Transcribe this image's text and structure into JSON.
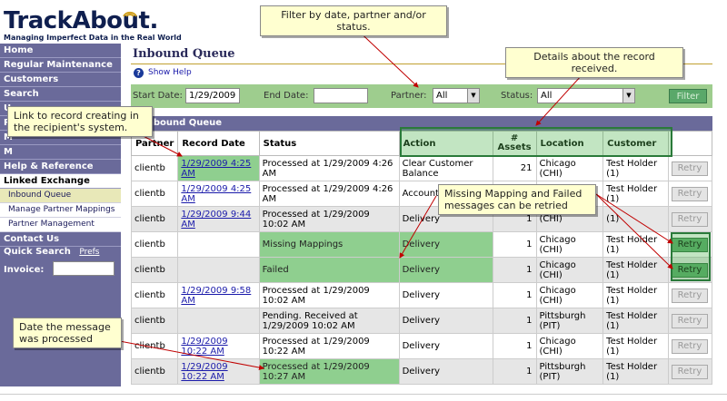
{
  "logo": {
    "name": "TrackAbout.",
    "tagline": "Managing Imperfect Data in the Real World"
  },
  "sidebar": {
    "sections": [
      "Home",
      "Regular Maintenance",
      "Customers",
      "Search",
      "U",
      "R",
      "M",
      "M"
    ],
    "help": "Help & Reference",
    "linked": "Linked Exchange",
    "sub_items": [
      "Inbound Queue",
      "Manage Partner Mappings",
      "Partner Management"
    ],
    "contact": "Contact Us",
    "quick_search": "Quick Search",
    "prefs": "Prefs",
    "invoice_label": "Invoice:",
    "invoice_value": ""
  },
  "page": {
    "title": "Inbound Queue",
    "show_help": "Show Help"
  },
  "filter": {
    "start_label": "Start Date:",
    "start_value": "1/29/2009",
    "end_label": "End Date:",
    "end_value": "",
    "partner_label": "Partner:",
    "partner_value": "All",
    "status_label": "Status:",
    "status_value": "All",
    "button": "Filter"
  },
  "grid": {
    "heading": "Inbound Queue",
    "columns": [
      "Partner",
      "Record Date",
      "Status",
      "Action",
      "# Assets",
      "Location",
      "Customer",
      ""
    ],
    "rows": [
      {
        "partner": "clientb",
        "date": "1/29/2009 4:25 AM",
        "status": "Processed at 1/29/2009 4:26 AM",
        "action": "Clear Customer Balance",
        "assets": "21",
        "location": "Chicago (CHI)",
        "customer": "Test Holder (1)",
        "retry": "Retry"
      },
      {
        "partner": "clientb",
        "date": "1/29/2009 4:25 AM",
        "status": "Processed at 1/29/2009 4:26 AM",
        "action": "Account Adjustm",
        "assets": "",
        "location": "",
        "customer": "Test Holder (1)",
        "retry": "Retry"
      },
      {
        "partner": "clientb",
        "date": "1/29/2009 9:44 AM",
        "status": "Processed at 1/29/2009 10:02 AM",
        "action": "Delivery",
        "assets": "1",
        "location": "(CHI)",
        "customer": "(1)",
        "retry": "Retry"
      },
      {
        "partner": "clientb",
        "date": "",
        "status": "Missing Mappings",
        "action": "Delivery",
        "assets": "1",
        "location": "Chicago (CHI)",
        "customer": "Test Holder (1)",
        "retry": "Retry"
      },
      {
        "partner": "clientb",
        "date": "",
        "status": "Failed",
        "action": "Delivery",
        "assets": "1",
        "location": "Chicago (CHI)",
        "customer": "Test Holder (1)",
        "retry": "Retry"
      },
      {
        "partner": "clientb",
        "date": "1/29/2009 9:58 AM",
        "status": "Processed at 1/29/2009 10:02 AM",
        "action": "Delivery",
        "assets": "1",
        "location": "Chicago (CHI)",
        "customer": "Test Holder (1)",
        "retry": "Retry"
      },
      {
        "partner": "clientb",
        "date": "",
        "status": "Pending. Received at 1/29/2009 10:02 AM",
        "action": "Delivery",
        "assets": "1",
        "location": "Pittsburgh (PIT)",
        "customer": "Test Holder (1)",
        "retry": "Retry"
      },
      {
        "partner": "clientb",
        "date": "1/29/2009 10:22 AM",
        "status": "Processed at 1/29/2009 10:22 AM",
        "action": "Delivery",
        "assets": "1",
        "location": "Chicago (CHI)",
        "customer": "Test Holder (1)",
        "retry": "Retry"
      },
      {
        "partner": "clientb",
        "date": "1/29/2009 10:22 AM",
        "status": "Processed at 1/29/2009 10:27 AM",
        "action": "Delivery",
        "assets": "1",
        "location": "Pittsburgh (PIT)",
        "customer": "Test Holder (1)",
        "retry": "Retry"
      }
    ]
  },
  "annotations": {
    "filter": "Filter by date, partner and/or status.",
    "details": "Details about the record received.",
    "link": "Link to record creating in the recipient's system.",
    "retry": "Missing Mapping and Failed messages can be retried",
    "date": "Date the message was processed"
  }
}
